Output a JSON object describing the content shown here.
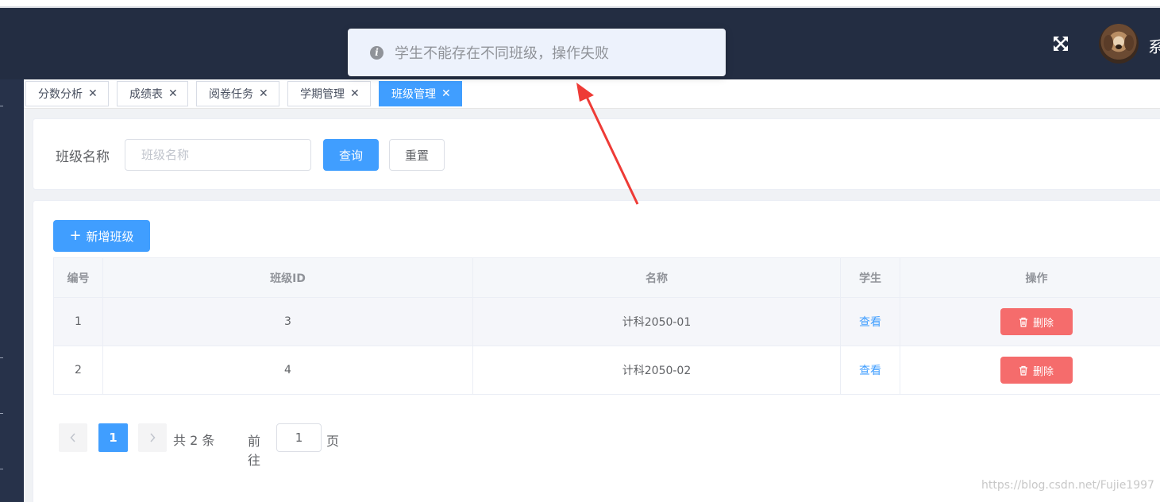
{
  "header": {
    "username": "系"
  },
  "tags": [
    {
      "label": "分数分析"
    },
    {
      "label": "成绩表"
    },
    {
      "label": "阅卷任务"
    },
    {
      "label": "学期管理"
    },
    {
      "label": "班级管理",
      "active": true
    }
  ],
  "search": {
    "label": "班级名称",
    "placeholder": "班级名称",
    "value": "",
    "query_label": "查询",
    "reset_label": "重置"
  },
  "toolbar": {
    "add_label": "新增班级"
  },
  "table": {
    "columns": [
      "编号",
      "班级ID",
      "名称",
      "学生",
      "操作"
    ],
    "rows": [
      {
        "index": "1",
        "class_id": "3",
        "name": "计科2050-01",
        "students_link": "查看",
        "delete_label": "删除"
      },
      {
        "index": "2",
        "class_id": "4",
        "name": "计科2050-02",
        "students_link": "查看",
        "delete_label": "删除"
      }
    ]
  },
  "pagination": {
    "current_page": "1",
    "total_text": "共 2 条",
    "goto_label": "前往",
    "goto_value": "1",
    "page_suffix": "页"
  },
  "toast": {
    "message": "学生不能存在不同班级，操作失败"
  },
  "watermark": "https://blog.csdn.net/Fujie1997",
  "colors": {
    "primary": "#409eff",
    "danger": "#f56c6c",
    "header_bg": "#232d42",
    "sidebar_bg": "#27324a",
    "annotation_arrow": "#ee3b36"
  }
}
